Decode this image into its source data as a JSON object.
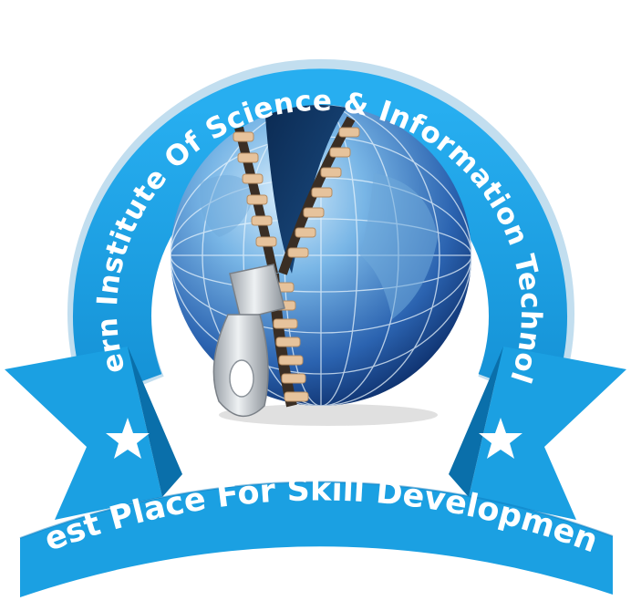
{
  "logo": {
    "institute_name": "Modern Institute Of Science & Information Technology",
    "tagline": "Best Place For Skill Development"
  },
  "colors": {
    "ring": "#1aa6ea",
    "ring_shadow": "#0b7cc0",
    "banner": "#1ba0e2",
    "banner_fold": "#0a6faa",
    "globe_light": "#9fd2f4",
    "globe_dark": "#123f86",
    "zipper_teeth": "#e6c39c",
    "zipper_tape": "#3a2e24",
    "pull": "#c9ced3"
  },
  "icons": [
    "star-icon",
    "globe-icon",
    "zipper-icon"
  ]
}
